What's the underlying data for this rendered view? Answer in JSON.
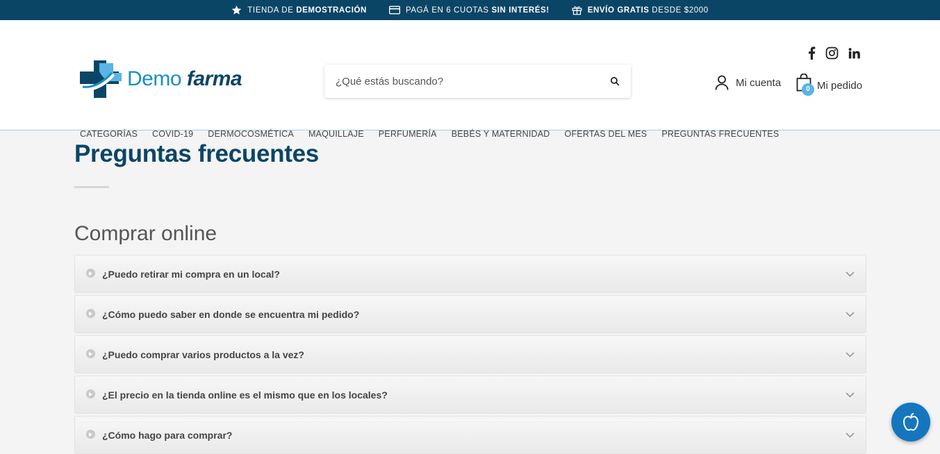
{
  "topbar": {
    "promos": [
      {
        "icon": "star-icon",
        "text_pre": "TIENDA DE ",
        "text_bold": "DEMOSTRACIÓN",
        "text_post": ""
      },
      {
        "icon": "credit-card-icon",
        "text_pre": "PAGÁ EN 6 CUOTAS ",
        "text_bold": "SIN INTERÉS!",
        "text_post": ""
      },
      {
        "icon": "gift-icon",
        "text_pre": "",
        "text_bold": "ENVÍO GRATIS",
        "text_post": " DESDE $2000"
      }
    ]
  },
  "header": {
    "logo": {
      "part1": "Demo",
      "part2": "farma"
    },
    "search": {
      "placeholder": "¿Qué estás buscando?"
    },
    "account_label": "Mi cuenta",
    "cart_label": "Mi pedido",
    "cart_count": "0"
  },
  "nav": {
    "items": [
      "CATEGORÍAS",
      "COVID-19",
      "DERMOCOSMÉTICA",
      "MAQUILLAJE",
      "PERFUMERÍA",
      "BEBÉS Y MATERNIDAD",
      "OFERTAS DEL MES",
      "PREGUNTAS FRECUENTES"
    ]
  },
  "page": {
    "title": "Preguntas frecuentes",
    "section_title": "Comprar online",
    "faqs": [
      "¿Puedo retirar mi compra en un local?",
      "¿Cómo puedo saber en donde se encuentra mi pedido?",
      "¿Puedo comprar varios productos a la vez?",
      "¿El precio en la tienda online es el mismo que en los locales?",
      "¿Cómo hago para comprar?"
    ]
  },
  "colors": {
    "brand_dark": "#0b4566",
    "brand_light": "#1a8fc9",
    "badge": "#5bb3e6",
    "fab": "#1576bf"
  }
}
